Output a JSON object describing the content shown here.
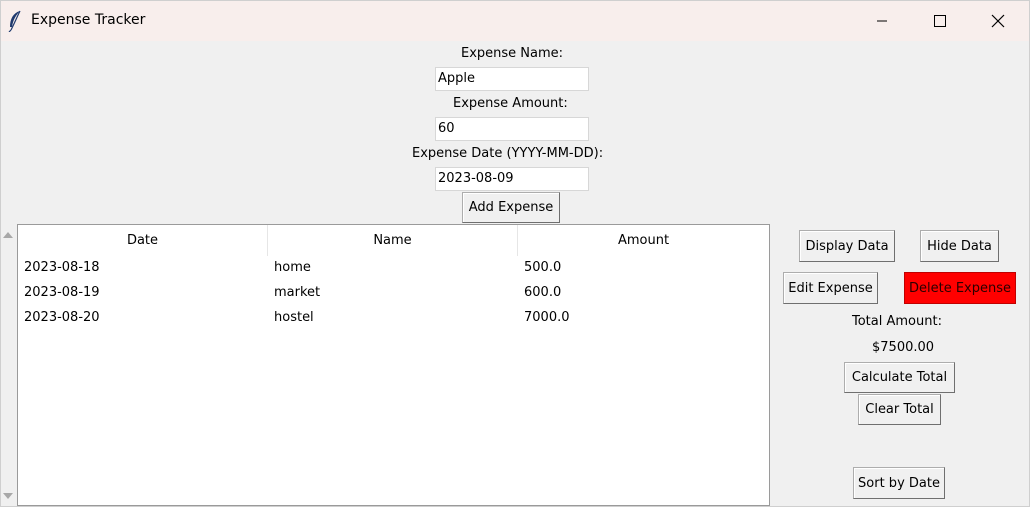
{
  "window": {
    "title": "Expense Tracker",
    "controls": {
      "minimize": "minimize",
      "maximize": "maximize",
      "close": "close"
    }
  },
  "form": {
    "name_label": "Expense Name:",
    "name_value": "Apple",
    "amount_label": "Expense Amount:",
    "amount_value": "60",
    "date_label": "Expense Date (YYYY-MM-DD):",
    "date_value": "2023-08-09",
    "add_button": "Add Expense"
  },
  "table": {
    "columns": [
      "Date",
      "Name",
      "Amount"
    ],
    "rows": [
      {
        "date": "2023-08-18",
        "name": "home",
        "amount": "500.0"
      },
      {
        "date": "2023-08-19",
        "name": "market",
        "amount": "600.0"
      },
      {
        "date": "2023-08-20",
        "name": "hostel",
        "amount": "7000.0"
      }
    ]
  },
  "actions": {
    "display_data": "Display Data",
    "hide_data": "Hide Data",
    "edit_expense": "Edit Expense",
    "delete_expense": "Delete Expense",
    "total_label": "Total Amount:",
    "total_value": "$7500.00",
    "calculate_total": "Calculate Total",
    "clear_total": "Clear Total",
    "sort_by_date": "Sort by Date"
  },
  "colors": {
    "titlebar": "#f8eeec",
    "window_bg": "#f0f0f0",
    "delete_button": "#ff0000"
  },
  "icons": {
    "app": "feather-icon",
    "minimize": "minimize-icon",
    "maximize": "maximize-icon",
    "close": "close-icon",
    "scroll_up": "scroll-up-arrow-icon",
    "scroll_down": "scroll-down-arrow-icon"
  }
}
